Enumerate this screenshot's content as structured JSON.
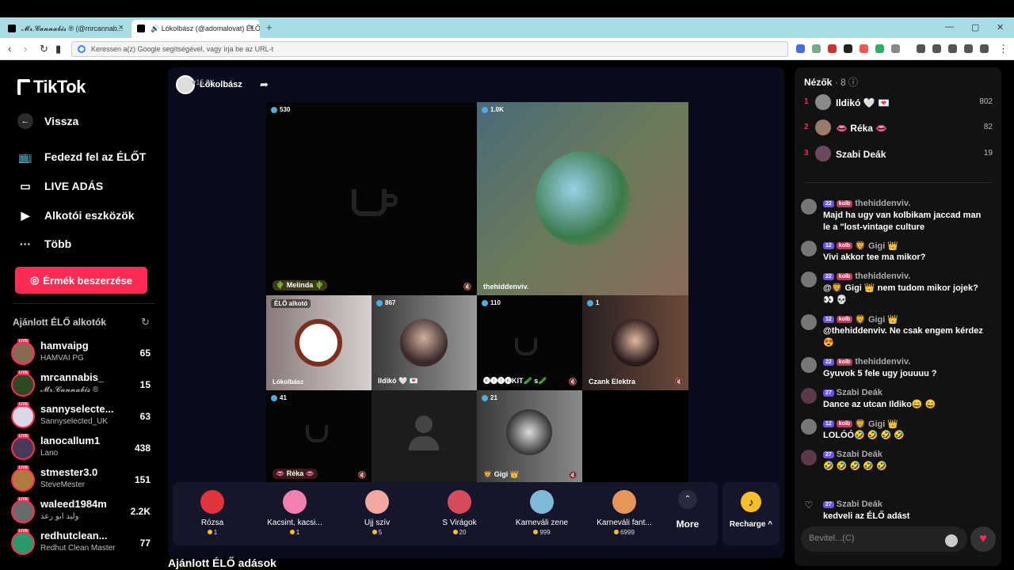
{
  "browser": {
    "tabs": [
      {
        "label": "𝓜𝓻.𝓒𝓪𝓷𝓷𝓪𝓫𝓲𝓼 ® (@mrcannab..."
      },
      {
        "label": "🔊 Lókolbász (@adomalovat) ÉLŐ"
      }
    ],
    "omnibox_placeholder": "Keressen a(z) Google segítségével, vagy írja be az URL-t"
  },
  "sidebar": {
    "logo": "TikTok",
    "back": "Vissza",
    "nav": [
      {
        "label": "Fedezd fel az ÉLŐT",
        "icon": "live-tv-icon"
      },
      {
        "label": "LIVE ADÁS",
        "icon": "camera-icon"
      },
      {
        "label": "Alkotói eszközök",
        "icon": "creator-tools-icon"
      },
      {
        "label": "Több",
        "icon": "more-dots-icon"
      }
    ],
    "coin_button": "Érmék beszerzése",
    "suggested_title": "Ajánlott ÉLŐ alkotók",
    "creators": [
      {
        "username": "hamvaipg",
        "display": "HAMVAI PG",
        "count": "65"
      },
      {
        "username": "mrcannabis_",
        "display": "𝓜𝓻.𝓒𝓪𝓷𝓷𝓪𝓫𝓲𝓼 ®",
        "count": "15"
      },
      {
        "username": "sannyselecte...",
        "display": "Sannyselected_UK",
        "count": "63"
      },
      {
        "username": "lanocallum1",
        "display": "Lano",
        "count": "438"
      },
      {
        "username": "stmester3.0",
        "display": "SteveMester",
        "count": "151"
      },
      {
        "username": "waleed1984m",
        "display": "وليد ابو رعد",
        "count": "2.2K"
      },
      {
        "username": "redhutclean...",
        "display": "Redhut Clean Master",
        "count": "77"
      }
    ]
  },
  "stream": {
    "host_name": "Lókolbász",
    "host_likes": "♥15.9K",
    "cells": [
      {
        "viewers": "530",
        "name": "🌵 Melinda 🌵"
      },
      {
        "viewers": "1.0K",
        "name": "thehiddenviv."
      },
      {
        "viewers": "ÉLŐ alkotó",
        "name": "Lókolbász"
      },
      {
        "viewers": "867",
        "name": "Ildikó 🤍 💌"
      },
      {
        "viewers": "110",
        "name": "🅚🅘🅣🅚KIT🥒 s🥒"
      },
      {
        "viewers": "1",
        "name": "Czank Elektra"
      },
      {
        "viewers": "41",
        "name": "👄 Réka 👄"
      },
      {
        "viewers": "",
        "name": ""
      },
      {
        "viewers": "21",
        "name": "🦁 Gigi 👑"
      }
    ],
    "gifts": [
      {
        "name": "Rózsa",
        "price": "1",
        "color": "#e0333a"
      },
      {
        "name": "Kacsint, kacsi...",
        "price": "1",
        "color": "#f27fb0"
      },
      {
        "name": "Ujj szív",
        "price": "5",
        "color": "#f2a8a0"
      },
      {
        "name": "S Virágok",
        "price": "20",
        "color": "#d64a5c"
      },
      {
        "name": "Karneváli zene",
        "price": "999",
        "color": "#7fb9d8"
      },
      {
        "name": "Karneváli fant...",
        "price": "6999",
        "color": "#e7965a"
      }
    ],
    "more_label": "More",
    "recharge_label": "Recharge ^",
    "recommended_title": "Ajánlott ÉLŐ adások"
  },
  "chat": {
    "viewers_title": "Nézők",
    "viewers_count": "· 8",
    "top_viewers": [
      {
        "rank": "1",
        "name": "Ildikó 🤍 💌",
        "score": "802"
      },
      {
        "rank": "2",
        "name": "👄 Réka 👄",
        "score": "82"
      },
      {
        "rank": "3",
        "name": "Szabi Deák",
        "score": "19"
      }
    ],
    "messages": [
      {
        "lvl": "22",
        "fan": "kolb",
        "user": "thehiddenviv.",
        "text": "Majd ha ugy van kolbikam jaccad man le a \"lost-vintage culture"
      },
      {
        "lvl": "12",
        "fan": "kolb",
        "user": "🦁 Gigi 👑",
        "text": "Vivi akkor tee ma mikor?"
      },
      {
        "lvl": "22",
        "fan": "kolb",
        "user": "thehiddenviv.",
        "text": "@🦁 Gigi 👑 nem tudom mikor jojek? 👀 💀"
      },
      {
        "lvl": "12",
        "fan": "kolb",
        "user": "🦁 Gigi 👑",
        "text": "@thehiddenviv. Ne csak engem kérdez😍"
      },
      {
        "lvl": "22",
        "fan": "kolb",
        "user": "thehiddenviv.",
        "text": "Gyuvok 5 fele ugy jouuuu ?"
      },
      {
        "lvl": "27",
        "fan": "",
        "user": "Szabi Deák",
        "text": "Dance az utcan Ildiko😄 😄"
      },
      {
        "lvl": "12",
        "fan": "kolb",
        "user": "🦁 Gigi 👑",
        "text": "LOLÓÓ🤣 🤣 🤣 🤣"
      },
      {
        "lvl": "27",
        "fan": "",
        "user": "Szabi Deák",
        "text": "🤣 🤣 🤣 🤣 🤣"
      },
      {
        "lvl": "27",
        "fan": "",
        "user": "Szabi Deák",
        "text": "kedveli az ÉLŐ adást"
      }
    ],
    "input_placeholder": "Bevitel...(C)"
  }
}
